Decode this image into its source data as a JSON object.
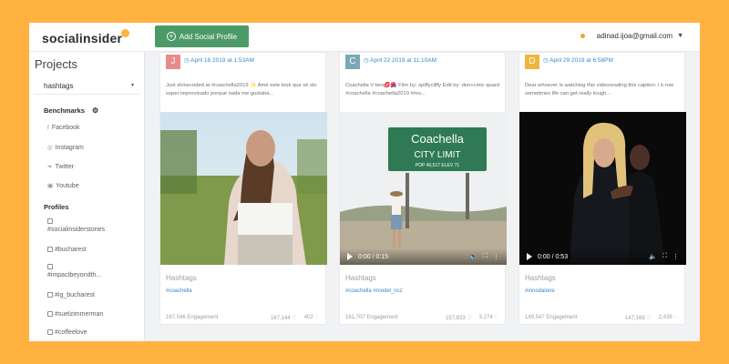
{
  "app": {
    "logo": "socialinsider",
    "add_profile_label": "Add Social Profile",
    "user_email": "adinad.ijoa@gmail.com"
  },
  "sidebar": {
    "projects_title": "Projects",
    "selected_project": "hashtags",
    "benchmarks_label": "Benchmarks",
    "networks": [
      {
        "label": "Facebook",
        "icon": "facebook-icon"
      },
      {
        "label": "Instagram",
        "icon": "instagram-icon"
      },
      {
        "label": "Twitter",
        "icon": "twitter-icon"
      },
      {
        "label": "Youtube",
        "icon": "youtube-icon"
      }
    ],
    "profiles_label": "Profiles",
    "profiles": [
      "#socialinsiderstories",
      "#bucharest",
      "#impactbeyondth...",
      "#ig_bucharest",
      "#suelzimmerman",
      "#coffeelove"
    ]
  },
  "posts": [
    {
      "avatar_letter": "J",
      "avatar_color": "#e98b8b",
      "date": "April 16 2019 at 1:53AM",
      "caption": "Just shinecoded at #coachella2019 ✨ Amé este look que sé slo super improvisado porque nada me gustaba...",
      "hashtags_label": "Hashtags",
      "tags": "#coachella",
      "engagement": "167,546 Engagement",
      "likes": "167,144",
      "comments": "402",
      "has_controls": false
    },
    {
      "avatar_letter": "C",
      "avatar_color": "#7aa8b8",
      "date": "April 22 2019 at 11:10AM",
      "caption": "Coachella V bes💋🌺 Film by: spiffycliffy Edit by: don+cmic quard #coachella #coachella2019 #mo...",
      "hashtags_label": "Hashtags",
      "tags": "#coachella #model_ncz",
      "engagement": "161,707 Engagement",
      "likes": "157,833",
      "comments": "3,274",
      "time": "0:00 / 0:15",
      "has_controls": true
    },
    {
      "avatar_letter": "D",
      "avatar_color": "#f2b43b",
      "date": "April 29 2019 at 6:58PM",
      "caption": "Dear whoever is watching this videoreading this caption: I k row sometimes life can get really tough...",
      "hashtags_label": "Hashtags",
      "tags": "#innodalone",
      "engagement": "149,547 Engagement",
      "likes": "147,168",
      "comments": "2,439",
      "time": "0:00 / 0:53",
      "has_controls": true
    }
  ]
}
